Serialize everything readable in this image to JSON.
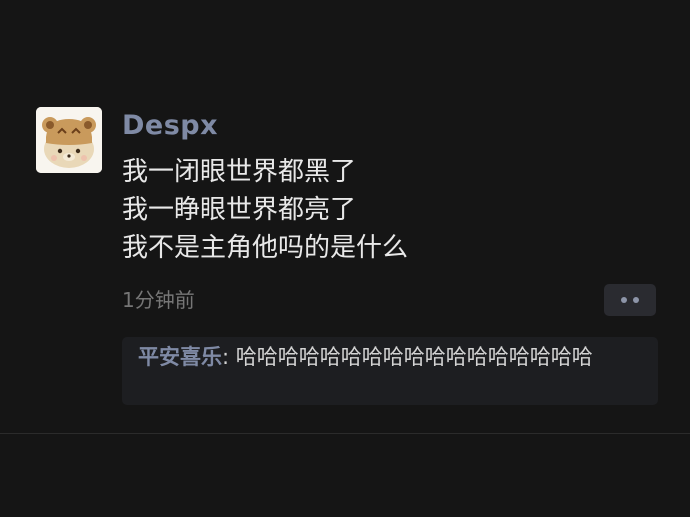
{
  "post": {
    "author": "Despx",
    "lines": [
      "我一闭眼世界都黑了",
      "我一睁眼世界都亮了",
      "我不是主角他吗的是什么"
    ],
    "timestamp": "1分钟前",
    "avatar_icon": "bear-avatar-icon",
    "more_icon": "more-dots-icon"
  },
  "comment": {
    "author": "平安喜乐",
    "separator": ": ",
    "text": "哈哈哈哈哈哈哈哈哈哈哈哈哈哈哈哈哈"
  },
  "colors": {
    "background": "#151515",
    "name_accent": "#7f8aa5",
    "text": "#e8e8e8"
  }
}
